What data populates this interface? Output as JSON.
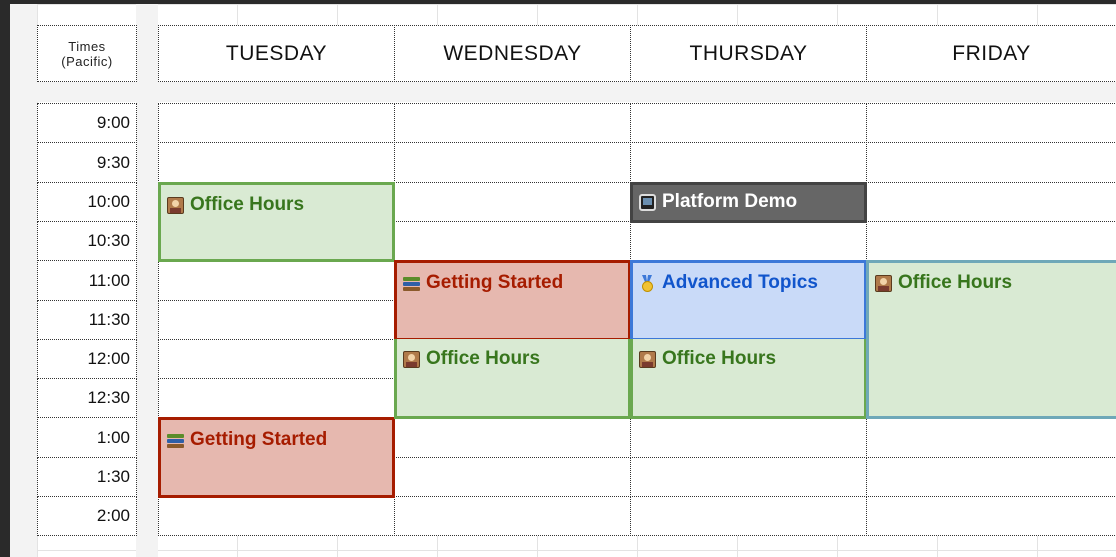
{
  "header": {
    "times_label_line1": "Times",
    "times_label_line2": "(Pacific)",
    "days": [
      "TUESDAY",
      "WEDNESDAY",
      "THURSDAY",
      "FRIDAY"
    ]
  },
  "times": [
    "9:00",
    "9:30",
    "10:00",
    "10:30",
    "11:00",
    "11:30",
    "12:00",
    "12:30",
    "1:00",
    "1:30",
    "2:00"
  ],
  "events": {
    "tue_office_hours": {
      "label": "Office Hours",
      "icon": "professor-icon"
    },
    "tue_getting_started": {
      "label": "Getting Started",
      "icon": "books-icon"
    },
    "wed_getting_started": {
      "label": "Getting Started",
      "icon": "books-icon"
    },
    "wed_office_hours": {
      "label": "Office Hours",
      "icon": "professor-icon"
    },
    "thu_platform_demo": {
      "label": "Platform Demo",
      "icon": "television-icon"
    },
    "thu_advanced_topics": {
      "label": "Advanced Topics",
      "icon": "medal-icon"
    },
    "thu_office_hours": {
      "label": "Office Hours",
      "icon": "professor-icon"
    },
    "fri_office_hours": {
      "label": "Office Hours",
      "icon": "professor-icon"
    }
  },
  "colors": {
    "office_hours": "#d9ead3",
    "getting_started": "#e6b8af",
    "advanced_topics": "#c9daf8",
    "platform_demo": "#666666"
  }
}
